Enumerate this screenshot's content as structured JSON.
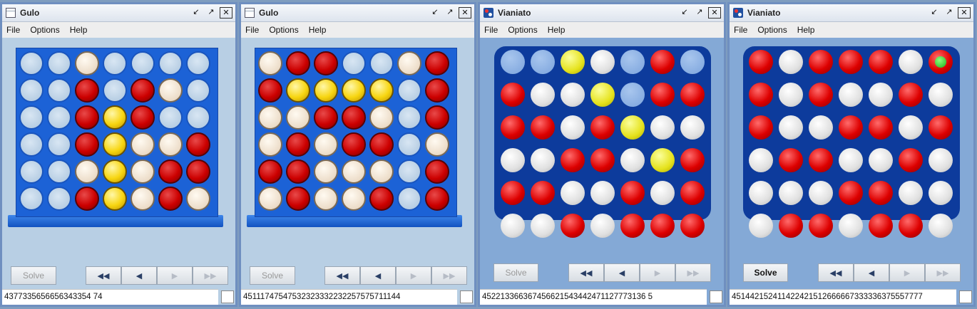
{
  "menu": {
    "file": "File",
    "options": "Options",
    "help": "Help"
  },
  "windows": [
    {
      "title": "Gulo",
      "style": "gulo",
      "solve_label": "Solve",
      "solve_enabled": false,
      "status": "4377335656656343354 74",
      "board": [
        "EECEEEE",
        "EERERCE",
        "EERYREE",
        "EERYCCR",
        "EECYCRR",
        "EERYCRC"
      ]
    },
    {
      "title": "Gulo",
      "style": "gulo",
      "solve_label": "Solve",
      "solve_enabled": false,
      "status": "45111747547532323332232257575711144",
      "board": [
        "CRREECR",
        "RYYYYER",
        "CCRRCER",
        "CRCRREC",
        "RRCCCER",
        "CRCCRER"
      ]
    },
    {
      "title": "Vianiato",
      "style": "via",
      "solve_label": "Solve",
      "solve_enabled": false,
      "status": "452213366367456621543442471127773136 5",
      "board": [
        "BBYWBRB",
        "RWWYBRR",
        "RRWRYWW",
        "WWRRWYR",
        "RRWWRWR",
        "WWRWRRR"
      ]
    },
    {
      "title": "Vianiato",
      "style": "via",
      "solve_label": "Solve",
      "solve_enabled": true,
      "status": "451442152411422421512666667333336375557777",
      "board": [
        "RWRRRWG",
        "RWRWWRW",
        "RWWRRWR",
        "WRRWWRW",
        "WWWRRWW",
        "WRRWRRW"
      ]
    }
  ],
  "nav": {
    "first": "first-icon",
    "prev": "prev-icon",
    "next": "next-icon",
    "last": "last-icon"
  },
  "colors": {
    "gulo_board": "#1c62d6",
    "via_board": "#0d3b9c",
    "red": "#cc0000",
    "yellow": "#f7d510"
  }
}
